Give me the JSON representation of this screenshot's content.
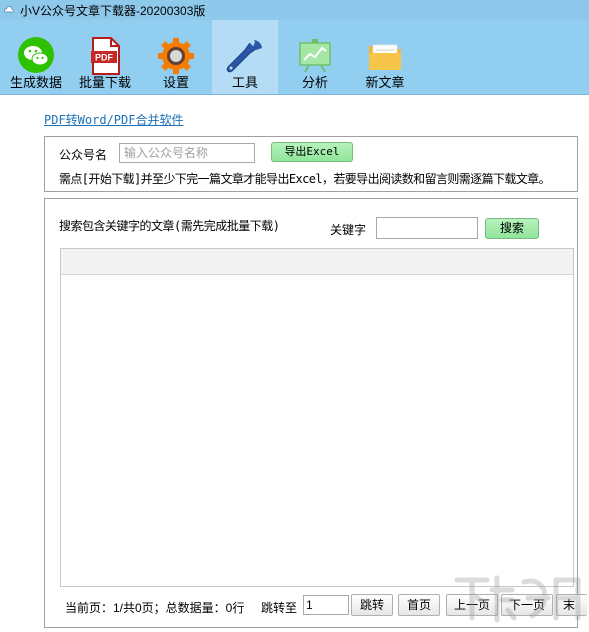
{
  "window": {
    "title": "小V公众号文章下载器-20200303版"
  },
  "toolbar": {
    "items": [
      {
        "label": "生成数据",
        "icon": "wechat-icon",
        "color": "#2dc100"
      },
      {
        "label": "批量下载",
        "icon": "pdf-icon",
        "color": "#c62828"
      },
      {
        "label": "设置",
        "icon": "gear-icon",
        "color": "#f57c00"
      },
      {
        "label": "工具",
        "icon": "wrench-icon",
        "color": "#2b56a8"
      },
      {
        "label": "分析",
        "icon": "chart-board-icon",
        "color": "#7bd67b"
      },
      {
        "label": "新文章",
        "icon": "folder-icon",
        "color": "#f2b233"
      }
    ],
    "active": "工具"
  },
  "tools": {
    "pdf_link": "PDF转Word/PDF合并软件",
    "account_label": "公众号名",
    "account_placeholder": "输入公众号名称",
    "export_button": "导出Excel",
    "note": "需点[开始下载]并至少下完一篇文章才能导出Excel，若要导出阅读数和留言则需逐篇下载文章。"
  },
  "search": {
    "title": "搜索包含关键字的文章(需先完成批量下载)",
    "keyword_label": "关键字",
    "keyword_value": "",
    "button": "搜索"
  },
  "pager": {
    "info": "当前页：1/共0页；总数据量：0行",
    "jump_label": "跳转至",
    "page_value": "1",
    "jump_button": "跳转",
    "first_button": "首页",
    "prev_button": "上一页",
    "next_button": "下一页",
    "last_button": "末"
  },
  "colors": {
    "titlebar": "#8ec9ec",
    "ribbon": "#92cef0",
    "link": "#1c72b8",
    "green_button": "#9be8a3"
  }
}
